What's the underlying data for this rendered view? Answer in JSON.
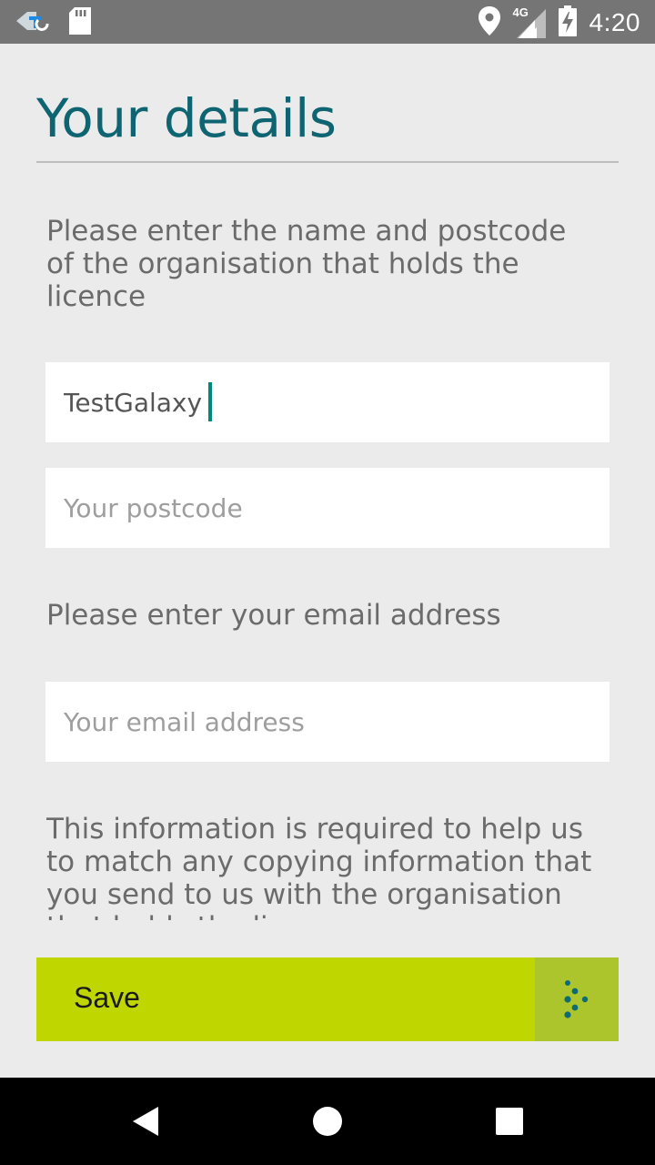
{
  "status_bar": {
    "time": "4:20",
    "network": "4G",
    "icons": [
      "app-notification-icon",
      "sd-card-icon",
      "location-icon",
      "signal-4g-icon",
      "battery-charging-icon"
    ]
  },
  "page": {
    "title": "Your details",
    "intro": "Please enter the name and postcode of the organisation that holds the licence",
    "org_field": {
      "value": "TestGalaxy",
      "placeholder": ""
    },
    "postcode_field": {
      "value": "",
      "placeholder": "Your postcode"
    },
    "email_prompt": "Please enter your email address",
    "email_field": {
      "value": "",
      "placeholder": "Your email address"
    },
    "info": "This information is required to help us to match any copying information that you send to us with the organisation that holds the licence"
  },
  "save": {
    "label": "Save"
  },
  "colors": {
    "title": "#0e6571",
    "save_bg": "#bfd600",
    "spinner_bg": "#acc52d",
    "cursor": "#00897b"
  },
  "nav": {
    "buttons": [
      "back-icon",
      "home-icon",
      "recents-icon"
    ]
  }
}
